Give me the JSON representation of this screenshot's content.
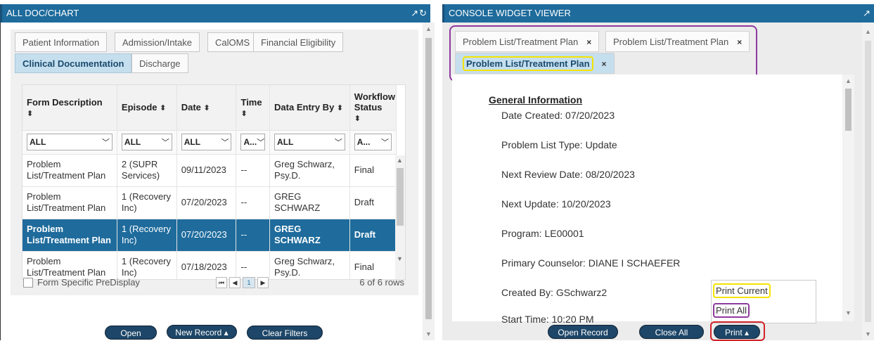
{
  "left": {
    "title": "ALL DOC/CHART",
    "header_icons": "↗↻",
    "tabs_row1": [
      "Patient Information",
      "Admission/Intake",
      "CalOMS",
      "Financial Eligibility"
    ],
    "tabs_row2": [
      "Clinical Documentation",
      "Discharge"
    ],
    "columns": [
      "Form Description",
      "Episode",
      "Date",
      "Time",
      "Data Entry By",
      "Workflow Status"
    ],
    "sort_glyph": "⬍",
    "filters": [
      "ALL",
      "ALL",
      "ALL",
      "A...",
      "ALL",
      "A..."
    ],
    "rows": [
      [
        "Problem List/Treatment Plan",
        "2 (SUPR Services)",
        "09/11/2023",
        "--",
        "Greg Schwarz, Psy.D.",
        "Final"
      ],
      [
        "Problem List/Treatment Plan",
        "1 (Recovery Inc)",
        "07/20/2023",
        "--",
        "GREG SCHWARZ",
        "Draft"
      ],
      [
        "Problem List/Treatment Plan",
        "1 (Recovery Inc)",
        "07/20/2023",
        "--",
        "GREG SCHWARZ",
        "Draft"
      ],
      [
        "Problem List/Treatment Plan",
        "1 (Recovery Inc)",
        "07/18/2023",
        "--",
        "Greg Schwarz, Psy.D.",
        "Final"
      ]
    ],
    "selected_row": 2,
    "predisplay_label": "Form Specific PreDisplay",
    "current_page": "1",
    "rows_count": "6 of 6 rows",
    "buttons": {
      "open": "Open",
      "new_record": "New Record ▴",
      "clear_filters": "Clear Filters"
    }
  },
  "right": {
    "title": "CONSOLE WIDGET VIEWER",
    "header_icon": "↗",
    "tabs": [
      {
        "label": "Problem List/Treatment Plan",
        "close": "×"
      },
      {
        "label": "Problem List/Treatment Plan",
        "close": "×"
      },
      {
        "label": "Problem List/Treatment Plan",
        "close": "×"
      }
    ],
    "doc": {
      "heading": "General Information",
      "lines": [
        "Date Created: 07/20/2023",
        "Problem List Type: Update",
        "Next Review Date: 08/20/2023",
        "Next Update: 10/20/2023",
        "Program: LE00001",
        "Primary Counselor: DIANE I SCHAEFER",
        "Created By: GSchwarz2",
        "Start Time: 10:20 PM"
      ]
    },
    "print_menu": [
      "Print Current",
      "Print All"
    ],
    "buttons": {
      "open_record": "Open Record",
      "close_all": "Close All",
      "print": "Print ▴"
    }
  },
  "colors": {
    "header": "#1e6b9c",
    "button": "#1d4668",
    "highlight_yellow": "#f4e300",
    "highlight_purple": "#8e3a9e",
    "highlight_red": "#d2232a"
  }
}
